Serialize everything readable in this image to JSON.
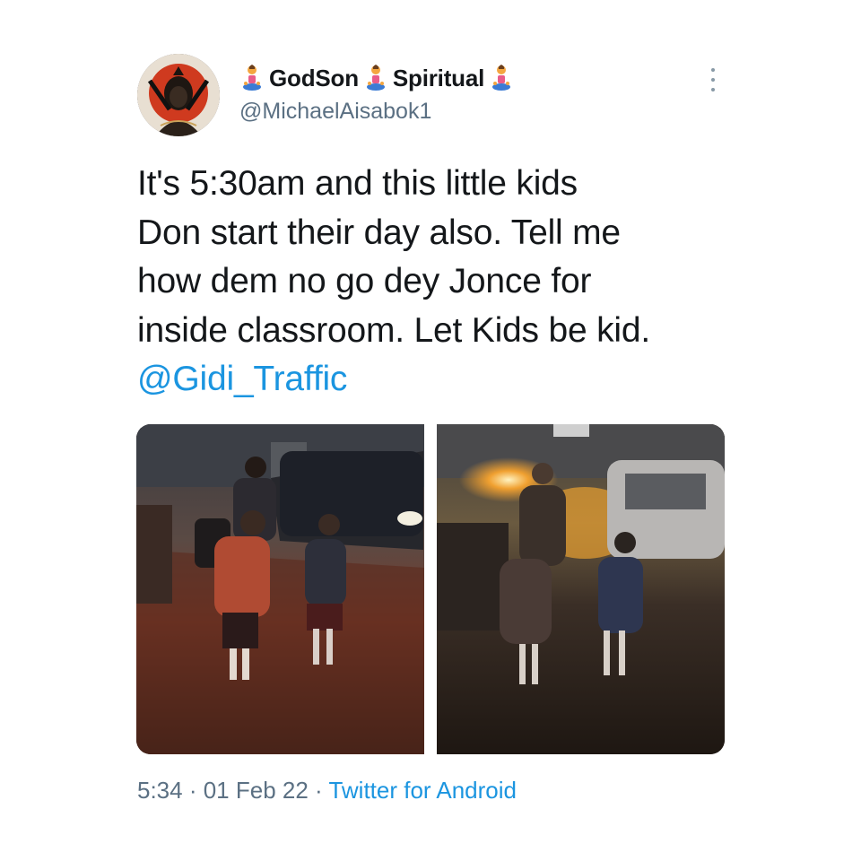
{
  "tweet": {
    "display_name_parts": [
      "GodSon",
      "Spiritual"
    ],
    "name_emoji_icon": "person-in-lotus-position-icon",
    "handle": "@MichaelAisabok1",
    "text_lines": [
      "It's 5:30am and this little kids",
      "Don start their day also. Tell me",
      "how dem no go dey Jonce for",
      "inside classroom. Let Kids be kid."
    ],
    "mention": "@Gidi_Traffic",
    "time": "5:34",
    "date": "01 Feb 22",
    "separator": " · ",
    "source": "Twitter for Android"
  },
  "colors": {
    "text": "#14171a",
    "secondary": "#5b7083",
    "link": "#1b95e0",
    "background": "#ffffff"
  },
  "icons": {
    "more": "more-vertical-icon",
    "avatar": "avatar"
  }
}
